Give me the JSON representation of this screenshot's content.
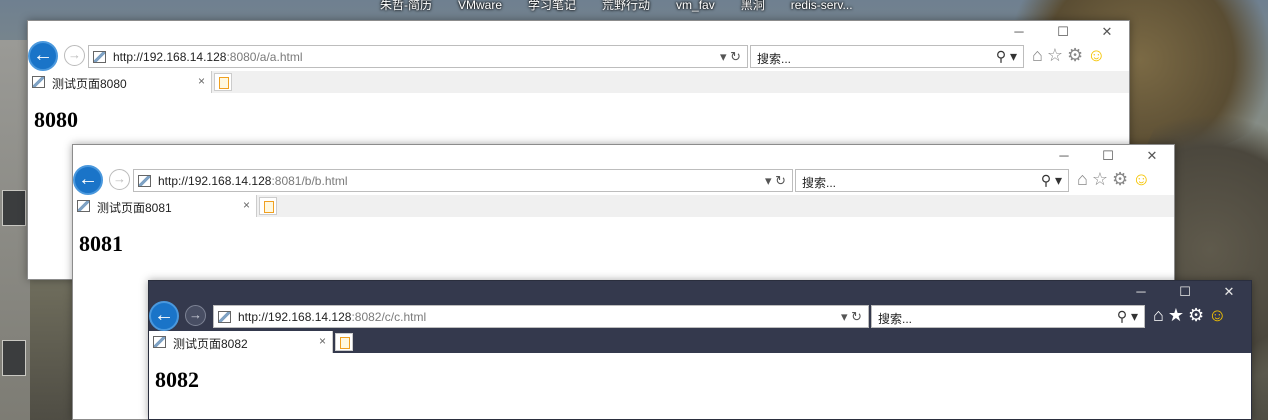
{
  "desktop": {
    "shortcuts": [
      "朱哲-简历",
      "VMware",
      "学习笔记",
      "荒野行动",
      "vm_fav",
      "黑洞",
      "redis-serv..."
    ]
  },
  "windows": [
    {
      "url_host": "http://192.168.14.128",
      "url_path": ":8080/a/a.html",
      "search_placeholder": "搜索...",
      "tab_title": "测试页面8080",
      "heading": "8080"
    },
    {
      "url_host": "http://192.168.14.128",
      "url_path": ":8081/b/b.html",
      "search_placeholder": "搜索...",
      "tab_title": "测试页面8081",
      "heading": "8081"
    },
    {
      "url_host": "http://192.168.14.128",
      "url_path": ":8082/c/c.html",
      "search_placeholder": "搜索...",
      "tab_title": "测试页面8082",
      "heading": "8082",
      "theme": "dark"
    }
  ],
  "icons": {
    "back": "←",
    "forward": "→",
    "minimize": "─",
    "maximize": "☐",
    "close": "✕",
    "dropdown": "▾",
    "refresh": "↻",
    "search": "⚲",
    "home": "⌂",
    "favorites": "☆",
    "favorites_filled": "★",
    "settings": "⚙",
    "feedback": "☺",
    "tab_close": "×"
  },
  "colors": {
    "accent": "#1a74c8",
    "dark_chrome": "#34394d",
    "smiley": "#f5c400"
  }
}
